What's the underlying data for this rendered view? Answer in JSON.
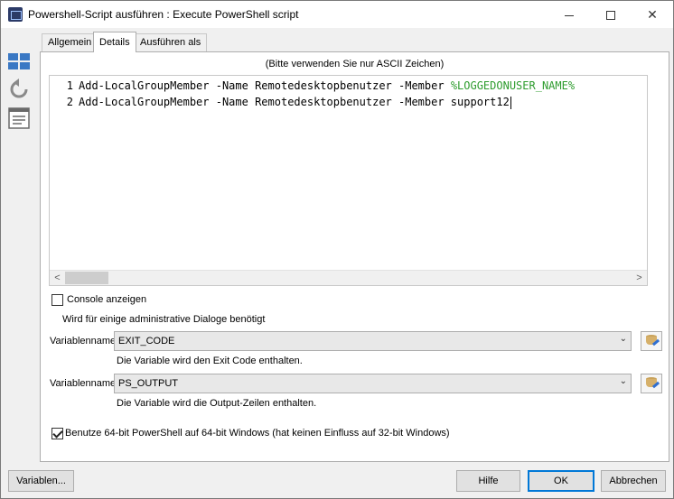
{
  "window": {
    "title": "Powershell-Script ausführen : Execute PowerShell script"
  },
  "tabs": [
    {
      "label": "Allgemein"
    },
    {
      "label": "Details"
    },
    {
      "label": "Ausführen als"
    }
  ],
  "details": {
    "hint": "(Bitte verwenden Sie nur ASCII Zeichen)",
    "code_lines": [
      {
        "number": "1",
        "text": "Add-LocalGroupMember -Name Remotedesktopbenutzer -Member ",
        "variable": "%LOGGEDONUSER_NAME%"
      },
      {
        "number": "2",
        "text": "Add-LocalGroupMember -Name Remotedesktopbenutzer -Member support12",
        "variable": ""
      }
    ],
    "console": {
      "label": "Console anzeigen",
      "checked": false,
      "note": "Wird für einige administrative Dialoge benötigt"
    },
    "exit_code_var": {
      "label": "Variablenname",
      "value": "EXIT_CODE",
      "note": "Die Variable wird den Exit Code enthalten."
    },
    "output_var": {
      "label": "Variablenname",
      "value": "PS_OUTPUT",
      "note": "Die Variable wird die Output-Zeilen enthalten."
    },
    "use64": {
      "label": "Benutze 64-bit PowerShell auf 64-bit Windows (hat keinen Einfluss auf 32-bit Windows)",
      "checked": true
    }
  },
  "footer": {
    "variables_label": "Variablen...",
    "help_label": "Hilfe",
    "ok_label": "OK",
    "cancel_label": "Abbrechen"
  },
  "colors": {
    "accent": "#0078d7",
    "variable_text": "#2e9c2e",
    "toolbar_icon": "#3a78c4"
  }
}
